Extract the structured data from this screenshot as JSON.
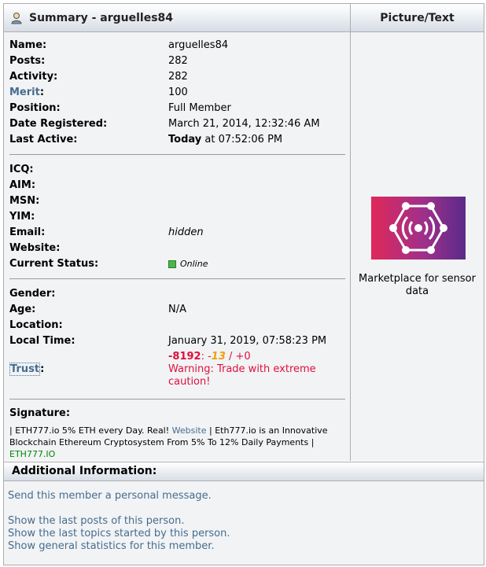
{
  "header": {
    "summary_title": "Summary - arguelles84",
    "picture_title": "Picture/Text"
  },
  "profile": {
    "name_label": "Name:",
    "name_value": "arguelles84",
    "posts_label": "Posts:",
    "posts_value": "282",
    "activity_label": "Activity:",
    "activity_value": "282",
    "merit_link": "Merit",
    "merit_colon": ":",
    "merit_value": "100",
    "position_label": "Position:",
    "position_value": "Full Member",
    "registered_label": "Date Registered:",
    "registered_value": "March 21, 2014, 12:32:46 AM",
    "last_active_label": "Last Active:",
    "last_active_today": "Today",
    "last_active_time": " at 07:52:06 PM"
  },
  "contact": {
    "icq_label": "ICQ:",
    "aim_label": "AIM:",
    "msn_label": "MSN:",
    "yim_label": "YIM:",
    "email_label": "Email:",
    "email_value": "hidden",
    "website_label": "Website:",
    "status_label": "Current Status:",
    "status_value": "Online"
  },
  "personal": {
    "gender_label": "Gender:",
    "age_label": "Age:",
    "age_value": "N/A",
    "location_label": "Location:",
    "local_time_label": "Local Time:",
    "local_time_value": "January 31, 2019, 07:58:23 PM"
  },
  "trust": {
    "label": "Trust",
    "colon": ":",
    "score_total": "-8192",
    "score_sep": ": -",
    "score_neg": "13",
    "score_pos": " / +0",
    "warning": "Warning: Trade with extreme caution!"
  },
  "signature": {
    "label": "Signature:",
    "part1": "| ETH777.io 5% ETH every Day. Real! ",
    "website": "Website",
    "part2": " | Eth777.io is an Innovative Blockchain Ethereum Cryptosystem From 5% To 12% Daily Payments | ",
    "domain": "ETH777.IO"
  },
  "picture": {
    "caption": "Marketplace for sensor data"
  },
  "additional": {
    "title": "Additional Information:",
    "links": [
      "Send this member a personal message.",
      "Show the last posts of this person.",
      "Show the last topics started by this person.",
      "Show general statistics for this member."
    ]
  },
  "colors": {
    "link": "#476c8e",
    "warning": "#e0103d",
    "online": "#48b848",
    "neg_score": "#f0a000"
  },
  "icons": {
    "header": "user-icon",
    "status": "online-dot-icon",
    "picture": "sensor-hexagon-logo"
  }
}
